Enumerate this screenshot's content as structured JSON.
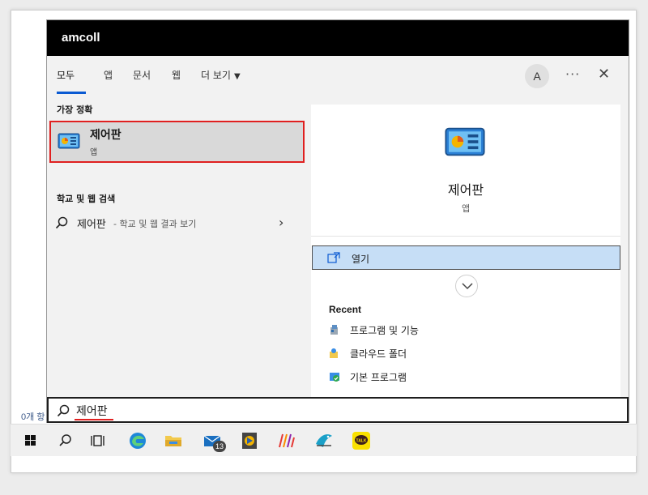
{
  "window": {
    "title": "amcoll"
  },
  "tabs": [
    {
      "label": "모두"
    },
    {
      "label": "앱"
    },
    {
      "label": "문서"
    },
    {
      "label": "웹"
    },
    {
      "label": "더 보기"
    }
  ],
  "header": {
    "avatar_letter": "A",
    "more_glyph": "···",
    "close_glyph": "✕"
  },
  "left": {
    "best_match_heading": "가장 정확",
    "best_match": {
      "name": "제어판",
      "type": "앱"
    },
    "web_heading": "학교 및 웹 검색",
    "web_result": {
      "term": "제어판",
      "desc": "- 학교 및 웹 결과 보기"
    }
  },
  "right": {
    "app_name": "제어판",
    "app_type": "앱",
    "open_label": "열기",
    "recent_heading": "Recent",
    "recent": [
      {
        "label": "프로그램 및 기능",
        "icon": "programs-features-icon"
      },
      {
        "label": "클라우드 폴더",
        "icon": "cloud-folder-icon"
      },
      {
        "label": "기본 프로그램",
        "icon": "default-programs-icon"
      }
    ]
  },
  "search": {
    "value": "제어판"
  },
  "background": {
    "text": "0개 항"
  },
  "taskbar": {
    "items": [
      {
        "icon": "windows-start-icon"
      },
      {
        "icon": "search-icon"
      },
      {
        "icon": "task-view-icon"
      },
      {
        "icon": "edge-icon"
      },
      {
        "icon": "file-explorer-icon"
      },
      {
        "icon": "mail-icon",
        "badge": "13"
      },
      {
        "icon": "media-app-icon"
      },
      {
        "icon": "brush-app-icon"
      },
      {
        "icon": "bird-app-icon"
      },
      {
        "icon": "kakaotalk-icon",
        "text": "TALK"
      }
    ]
  },
  "colors": {
    "accent": "#0a5ad2",
    "highlight_border": "#e02020",
    "open_button_bg": "#c6def6",
    "title_bar": "#000000"
  }
}
